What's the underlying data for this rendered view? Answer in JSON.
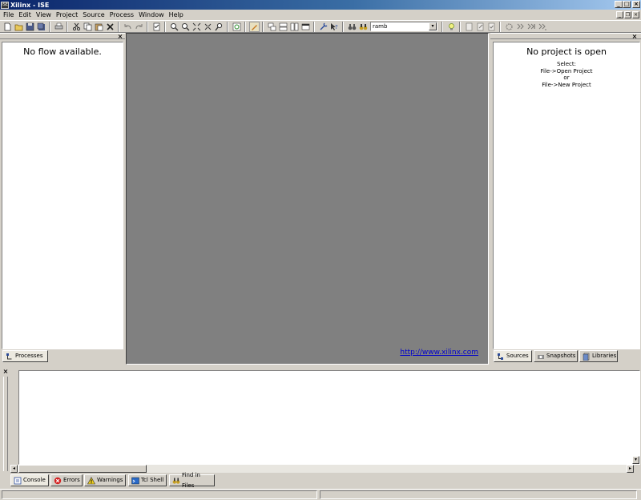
{
  "window": {
    "app_icon_text": "ISE",
    "title": "Xilinx - ISE",
    "caption_buttons": [
      "_",
      "□",
      "×"
    ]
  },
  "menu": [
    "File",
    "Edit",
    "View",
    "Project",
    "Source",
    "Process",
    "Window",
    "Help"
  ],
  "toolbar": {
    "search_value": "ramb",
    "search_dropdown_arrow": "▾"
  },
  "left_panel": {
    "message": "No flow available.",
    "close": "×",
    "tab": "Processes"
  },
  "center": {
    "link": "http://www.xilinx.com"
  },
  "right_panel": {
    "title": "No project is open",
    "close": "×",
    "lines": [
      "Select:",
      "File->Open Project",
      "or",
      "File->New Project"
    ],
    "tabs": [
      "Sources",
      "Snapshots",
      "Libraries"
    ]
  },
  "console": {
    "close": "×",
    "tabs": [
      "Console",
      "Errors",
      "Warnings",
      "Tcl Shell",
      "Find in Files"
    ]
  },
  "colors": {
    "titlebar_start": "#0a246a",
    "titlebar_end": "#a6caf0",
    "workspace": "#808080",
    "chrome": "#d4d0c8",
    "link": "#0000cc"
  }
}
